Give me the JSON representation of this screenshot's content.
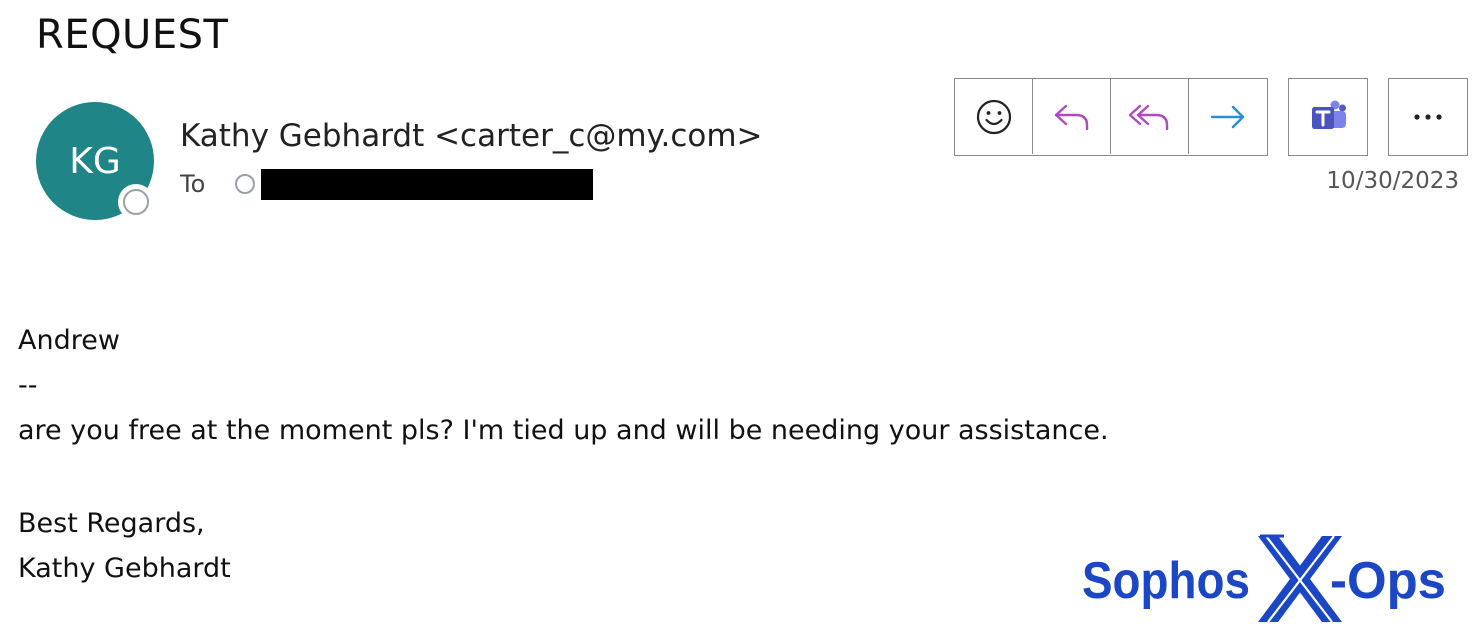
{
  "email": {
    "subject": "REQUEST",
    "sender": {
      "initials": "KG",
      "display": "Kathy Gebhardt <carter_c@my.com>",
      "avatar_color": "#1f8587"
    },
    "to_label": "To",
    "date": "10/30/2023",
    "body": {
      "greeting": "Andrew",
      "separator": "--",
      "message": "are you free at the moment pls? I'm tied up and will be needing your assistance.",
      "closing": "Best Regards,",
      "signature": "Kathy Gebhardt"
    }
  },
  "toolbar": {
    "icons": [
      "smiley-icon",
      "reply-icon",
      "reply-all-icon",
      "forward-icon",
      "teams-icon",
      "more-icon"
    ],
    "colors": {
      "reply": "#b04ac0",
      "forward": "#2a8fd0",
      "teams": "#5059c9"
    }
  },
  "watermark": {
    "text": "SophosX-Ops",
    "color": "#1b47c4"
  }
}
